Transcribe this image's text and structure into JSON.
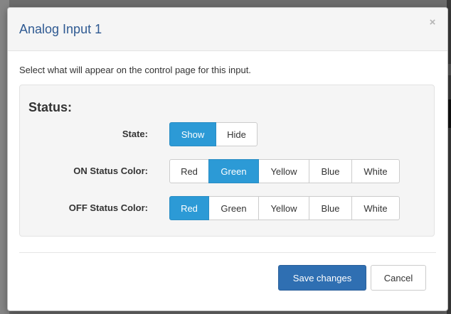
{
  "modal": {
    "title": "Analog Input 1",
    "close_glyph": "×",
    "description": "Select what will appear on the control page for this input."
  },
  "status": {
    "legend": "Status:",
    "state": {
      "label": "State:",
      "options": [
        "Show",
        "Hide"
      ],
      "selected": "Show"
    },
    "on_color": {
      "label": "ON Status Color:",
      "options": [
        "Red",
        "Green",
        "Yellow",
        "Blue",
        "White"
      ],
      "selected": "Green"
    },
    "off_color": {
      "label": "OFF Status Color:",
      "options": [
        "Red",
        "Green",
        "Yellow",
        "Blue",
        "White"
      ],
      "selected": "Red"
    }
  },
  "footer": {
    "save_label": "Save changes",
    "cancel_label": "Cancel"
  },
  "colors": {
    "title": "#2f5a92",
    "toggle_active": "#2c9ad6",
    "primary_button": "#2f6fb2"
  }
}
